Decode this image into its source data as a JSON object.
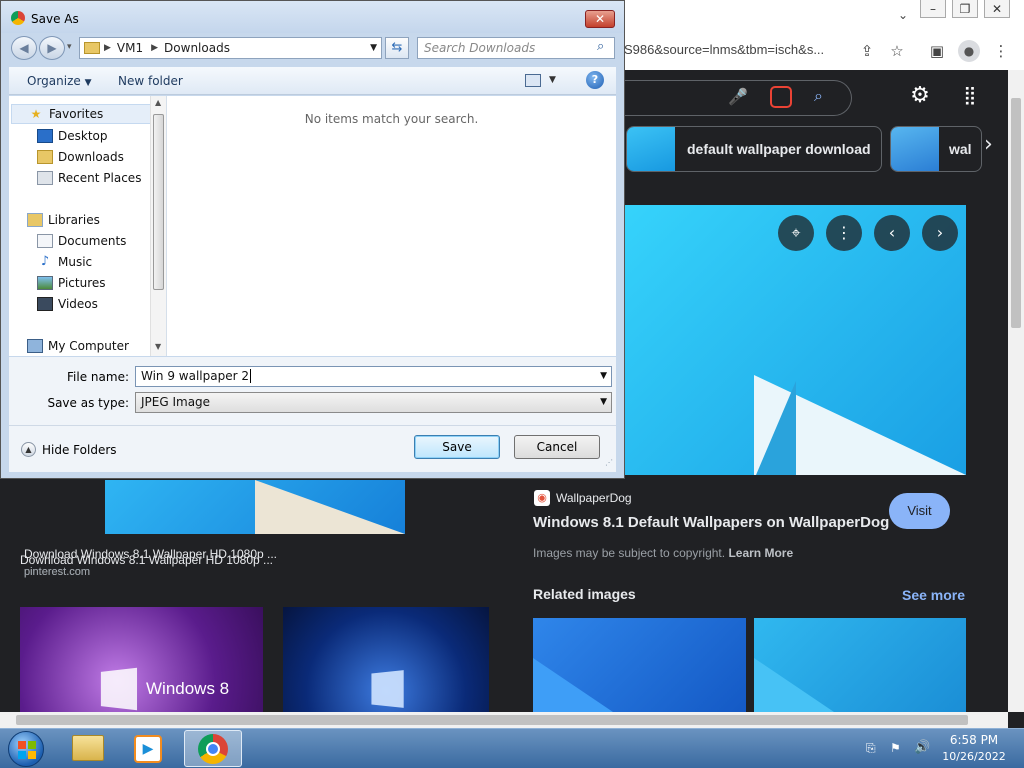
{
  "dialog": {
    "title": "Save As",
    "breadcrumb": [
      "VM1",
      "Downloads"
    ],
    "search_placeholder": "Search Downloads",
    "organize_label": "Organize",
    "new_folder_label": "New folder",
    "empty_message": "No items match your search.",
    "nav": {
      "favorites": "Favorites",
      "favorites_items": [
        "Desktop",
        "Downloads",
        "Recent Places"
      ],
      "libraries": "Libraries",
      "libraries_items": [
        "Documents",
        "Music",
        "Pictures",
        "Videos"
      ],
      "computer": "My Computer"
    },
    "file_name_label": "File name:",
    "file_name_value": "Win 9 wallpaper 2",
    "save_type_label": "Save as type:",
    "save_type_value": "JPEG Image",
    "hide_folders_label": "Hide Folders",
    "save_label": "Save",
    "cancel_label": "Cancel"
  },
  "browser": {
    "url_fragment": "S986&source=lnms&tbm=isch&s...",
    "chips": [
      "default wallpaper download",
      "wal"
    ],
    "preview": {
      "source": "WallpaperDog",
      "title": "Windows 8.1 Default Wallpapers on WallpaperDog",
      "visit_label": "Visit",
      "copyright_text": "Images may be subject to copyright.",
      "learn_more": "Learn More",
      "related_label": "Related images",
      "see_more": "See more"
    },
    "result": {
      "title": "Download Windows 8.1 Wallpaper HD 1080p ...",
      "site": "pinterest.com"
    },
    "thumb_caption": "Windows 8"
  },
  "taskbar": {
    "time": "6:58 PM",
    "date": "10/26/2022"
  }
}
